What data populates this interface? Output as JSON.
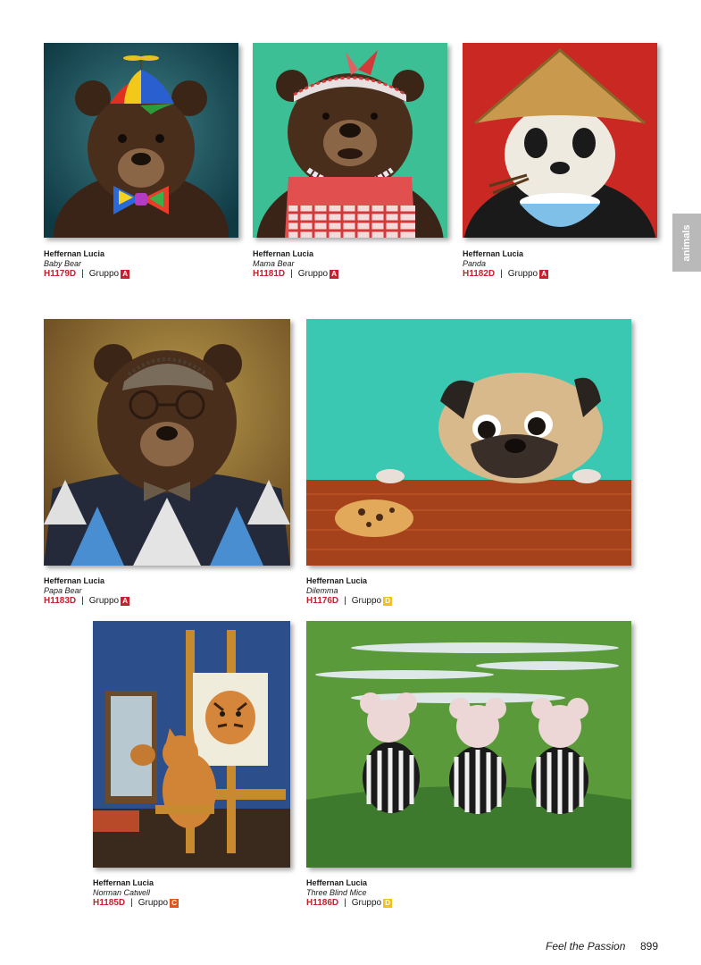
{
  "side_tab": {
    "label": "animals"
  },
  "badge_colors": {
    "A": "#c8202e",
    "C": "#e0561e",
    "D": "#f2c21a"
  },
  "items": [
    {
      "artist": "Heffernan Lucia",
      "title": "Baby Bear",
      "code": "H1179D",
      "group_label": "Gruppo",
      "group": "A"
    },
    {
      "artist": "Heffernan Lucia",
      "title": "Mama Bear",
      "code": "H1181D",
      "group_label": "Gruppo",
      "group": "A"
    },
    {
      "artist": "Heffernan Lucia",
      "title": "Panda",
      "code": "H1182D",
      "group_label": "Gruppo",
      "group": "A"
    },
    {
      "artist": "Heffernan Lucia",
      "title": "Papa Bear",
      "code": "H1183D",
      "group_label": "Gruppo",
      "group": "A"
    },
    {
      "artist": "Heffernan Lucia",
      "title": "Dilemma",
      "code": "H1176D",
      "group_label": "Gruppo",
      "group": "D"
    },
    {
      "artist": "Heffernan Lucia",
      "title": "Norman Catwell",
      "code": "H1185D",
      "group_label": "Gruppo",
      "group": "C"
    },
    {
      "artist": "Heffernan Lucia",
      "title": "Three Blind Mice",
      "code": "H1186D",
      "group_label": "Gruppo",
      "group": "D"
    }
  ],
  "footer": {
    "slogan": "Feel the Passion",
    "page_number": "899"
  }
}
